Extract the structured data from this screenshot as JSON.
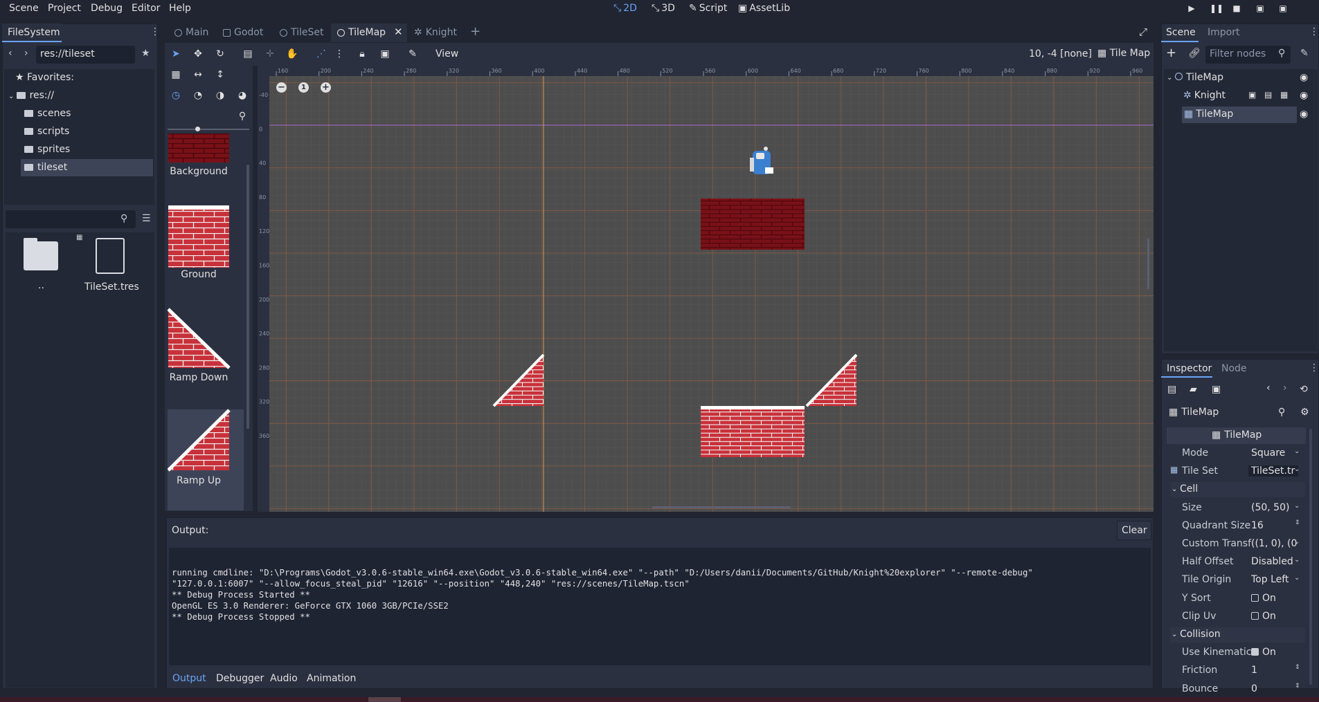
{
  "menubar": {
    "items": [
      "Scene",
      "Project",
      "Debug",
      "Editor",
      "Help"
    ]
  },
  "workspaces": [
    {
      "label": "2D",
      "icon": "2d-icon",
      "active": true
    },
    {
      "label": "3D",
      "icon": "3d-icon"
    },
    {
      "label": "Script",
      "icon": "script-icon"
    },
    {
      "label": "AssetLib",
      "icon": "assetlib-icon"
    }
  ],
  "run_controls": {
    "icons": [
      "play-icon",
      "pause-icon",
      "stop-icon",
      "play-scene-icon",
      "play-custom-scene-icon"
    ]
  },
  "filesystem": {
    "title": "FileSystem",
    "path": "res://tileset",
    "favorites": "Favorites:",
    "root": "res://",
    "folders": [
      "scenes",
      "scripts",
      "sprites",
      "tileset"
    ],
    "selected": "tileset",
    "files": [
      "..",
      "TileSet.tres"
    ]
  },
  "editor_tabs": [
    {
      "label": "Main"
    },
    {
      "label": "Godot"
    },
    {
      "label": "TileSet"
    },
    {
      "label": "TileMap",
      "active": true
    },
    {
      "label": "Knight"
    }
  ],
  "toolbar": {
    "view_label": "View",
    "coords": "10, -4 [none]",
    "tilemap_label": "Tile Map"
  },
  "tile_palette": [
    "Background",
    "Ground",
    "Ramp Down",
    "Ramp Up"
  ],
  "ruler": {
    "h_ticks": [
      "160",
      "200",
      "240",
      "280",
      "320",
      "360",
      "400",
      "440",
      "480",
      "520",
      "560",
      "600",
      "640",
      "680",
      "720",
      "760",
      "800",
      "840",
      "880",
      "920",
      "960"
    ],
    "v_ticks": [
      "-40",
      "0",
      "40",
      "80",
      "120",
      "160",
      "200",
      "240",
      "280",
      "320",
      "360"
    ]
  },
  "output": {
    "title": "Output:",
    "clear": "Clear",
    "lines": [
      "running cmdline: \"D:\\Programs\\Godot_v3.0.6-stable_win64.exe\\Godot_v3.0.6-stable_win64.exe\" \"--path\" \"D:/Users/danii/Documents/GitHub/Knight%20explorer\" \"--remote-debug\"",
      "\"127.0.0.1:6007\" \"--allow_focus_steal_pid\" \"12616\" \"--position\" \"448,240\" \"res://scenes/TileMap.tscn\"",
      "** Debug Process Started **",
      "OpenGL ES 3.0 Renderer: GeForce GTX 1060 3GB/PCIe/SSE2",
      "** Debug Process Stopped **"
    ],
    "tabs": [
      "Output",
      "Debugger",
      "Audio",
      "Animation"
    ]
  },
  "scene": {
    "tabs": [
      "Scene",
      "Import"
    ],
    "filter_placeholder": "Filter nodes",
    "nodes": [
      {
        "label": "TileMap",
        "icon": "node2d-icon"
      },
      {
        "label": "Knight",
        "icon": "kinematic-body-icon"
      },
      {
        "label": "TileMap",
        "icon": "tilemap-icon",
        "selected": true
      }
    ]
  },
  "inspector": {
    "tabs": [
      "Inspector",
      "Node"
    ],
    "object": "TileMap",
    "section": "TileMap",
    "props": [
      {
        "key": "Mode",
        "value": "Square"
      },
      {
        "key": "Tile Set",
        "value": "TileSet.tr"
      },
      {
        "category": "Cell"
      },
      {
        "key": "Size",
        "value": "(50, 50)"
      },
      {
        "key": "Quadrant Size",
        "value": "16"
      },
      {
        "key": "Custom Transf",
        "value": "((1, 0), (0"
      },
      {
        "key": "Half Offset",
        "value": "Disabled"
      },
      {
        "key": "Tile Origin",
        "value": "Top Left"
      },
      {
        "key": "Y Sort",
        "value": "On"
      },
      {
        "key": "Clip Uv",
        "value": "On"
      },
      {
        "category": "Collision"
      },
      {
        "key": "Use Kinematic",
        "value": "On"
      },
      {
        "key": "Friction",
        "value": "1"
      },
      {
        "key": "Bounce",
        "value": "0"
      }
    ]
  },
  "colors": {
    "accent": "#6aa4f8",
    "brick": "#c8313a",
    "brick_dark": "#7a1118",
    "viewport": "#4d4d4d"
  }
}
